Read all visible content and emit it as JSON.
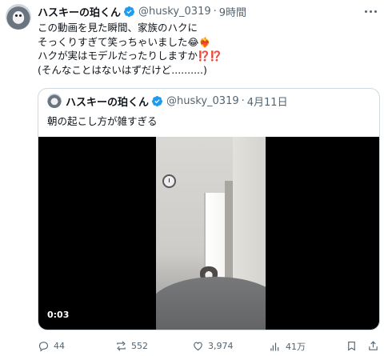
{
  "tweet": {
    "display_name": "ハスキーの珀くん",
    "handle": "@husky_0319",
    "separator": "·",
    "time": "9時間",
    "lines": [
      "この動画を見た瞬間、家族のハクに",
      "そっくりすぎて笑っちゃいました",
      "ハクが実はモデルだったりしますか",
      "(そんなことはないはずだけど..........)"
    ],
    "emoji_line2": "😂❤️‍🔥",
    "emoji_line3": "⁉️⁉️"
  },
  "quoted_tweet": {
    "display_name": "ハスキーの珀くん",
    "handle": "@husky_0319",
    "separator": "·",
    "date": "4月11日",
    "text": "朝の起こし方が雑すぎる",
    "video_time": "0:03"
  },
  "actions": {
    "replies": "44",
    "reposts": "552",
    "likes": "3,974",
    "views": "41万"
  },
  "colors": {
    "verified": "#1d9bf0",
    "muted": "#536471",
    "border": "#cfd9de"
  }
}
